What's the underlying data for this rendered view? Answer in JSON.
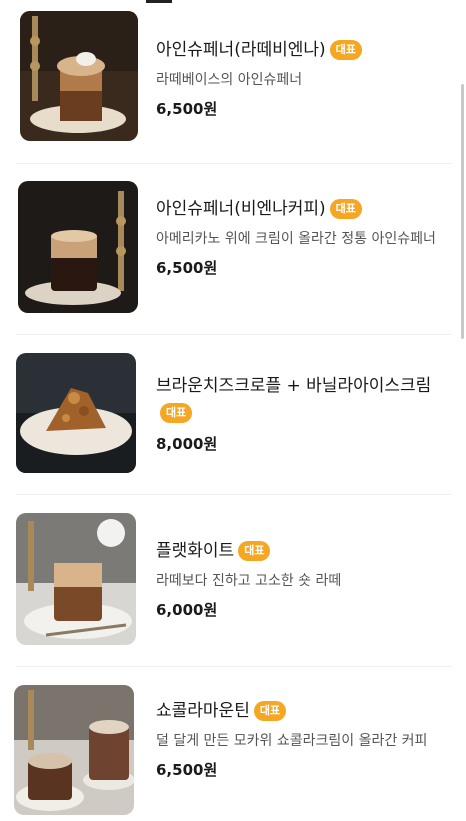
{
  "menu": {
    "badge_label": "대표",
    "items": [
      {
        "name": "아인슈페너(라떼비엔나)",
        "description": "라떼베이스의 아인슈페너",
        "price": "6,500원"
      },
      {
        "name": "아인슈페너(비엔나커피)",
        "description": "아메리카노 위에 크림이 올라간 정통 아인슈페너",
        "price": "6,500원"
      },
      {
        "name": "브라운치즈크로플 + 바닐라아이스크림",
        "description": "",
        "price": "8,000원"
      },
      {
        "name": "플랫화이트",
        "description": "라떼보다 진하고 고소한 숏 라떼",
        "price": "6,000원"
      },
      {
        "name": "쇼콜라마운틴",
        "description": "덜 달게 만든 모카위 쇼콜라크림이 올라간 커피",
        "price": "6,500원"
      }
    ]
  }
}
